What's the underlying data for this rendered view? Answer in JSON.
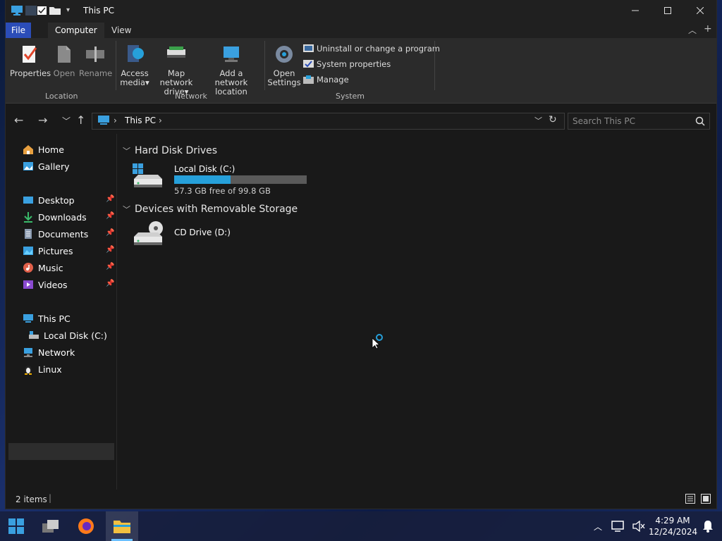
{
  "window": {
    "title": "This PC"
  },
  "ribbon_tabs": [
    "File",
    "Computer",
    "View"
  ],
  "ribbon": {
    "location": {
      "group_label": "Location",
      "properties": "Properties",
      "open": "Open",
      "rename": "Rename"
    },
    "network": {
      "group_label": "Network",
      "access_media": [
        "Access",
        "media"
      ],
      "map_drive": [
        "Map network",
        "drive"
      ],
      "add_location": [
        "Add a network",
        "location"
      ]
    },
    "system": {
      "group_label": "System",
      "open_settings": [
        "Open",
        "Settings"
      ],
      "uninstall": "Uninstall or change a program",
      "system_properties": "System properties",
      "manage": "Manage"
    }
  },
  "address": {
    "path": "This PC"
  },
  "search": {
    "placeholder": "Search This PC"
  },
  "sidebar": {
    "home": "Home",
    "gallery": "Gallery",
    "desktop": "Desktop",
    "downloads": "Downloads",
    "documents": "Documents",
    "pictures": "Pictures",
    "music": "Music",
    "videos": "Videos",
    "this_pc": "This PC",
    "local_disk": "Local Disk (C:)",
    "network": "Network",
    "linux": "Linux"
  },
  "content": {
    "hard_disk_header": "Hard Disk Drives",
    "local_disk": {
      "name": "Local Disk (C:)",
      "free_text": "57.3 GB free of 99.8 GB",
      "used_fraction": 0.426
    },
    "removable_header": "Devices with Removable Storage",
    "cd_drive": {
      "name": "CD Drive (D:)"
    }
  },
  "status": {
    "items": "2 items"
  },
  "taskbar": {
    "time": "4:29 AM",
    "date": "12/24/2024"
  },
  "colors": {
    "accent": "#2b4db8",
    "progress": "#26a0da",
    "window_bg": "#191919"
  }
}
